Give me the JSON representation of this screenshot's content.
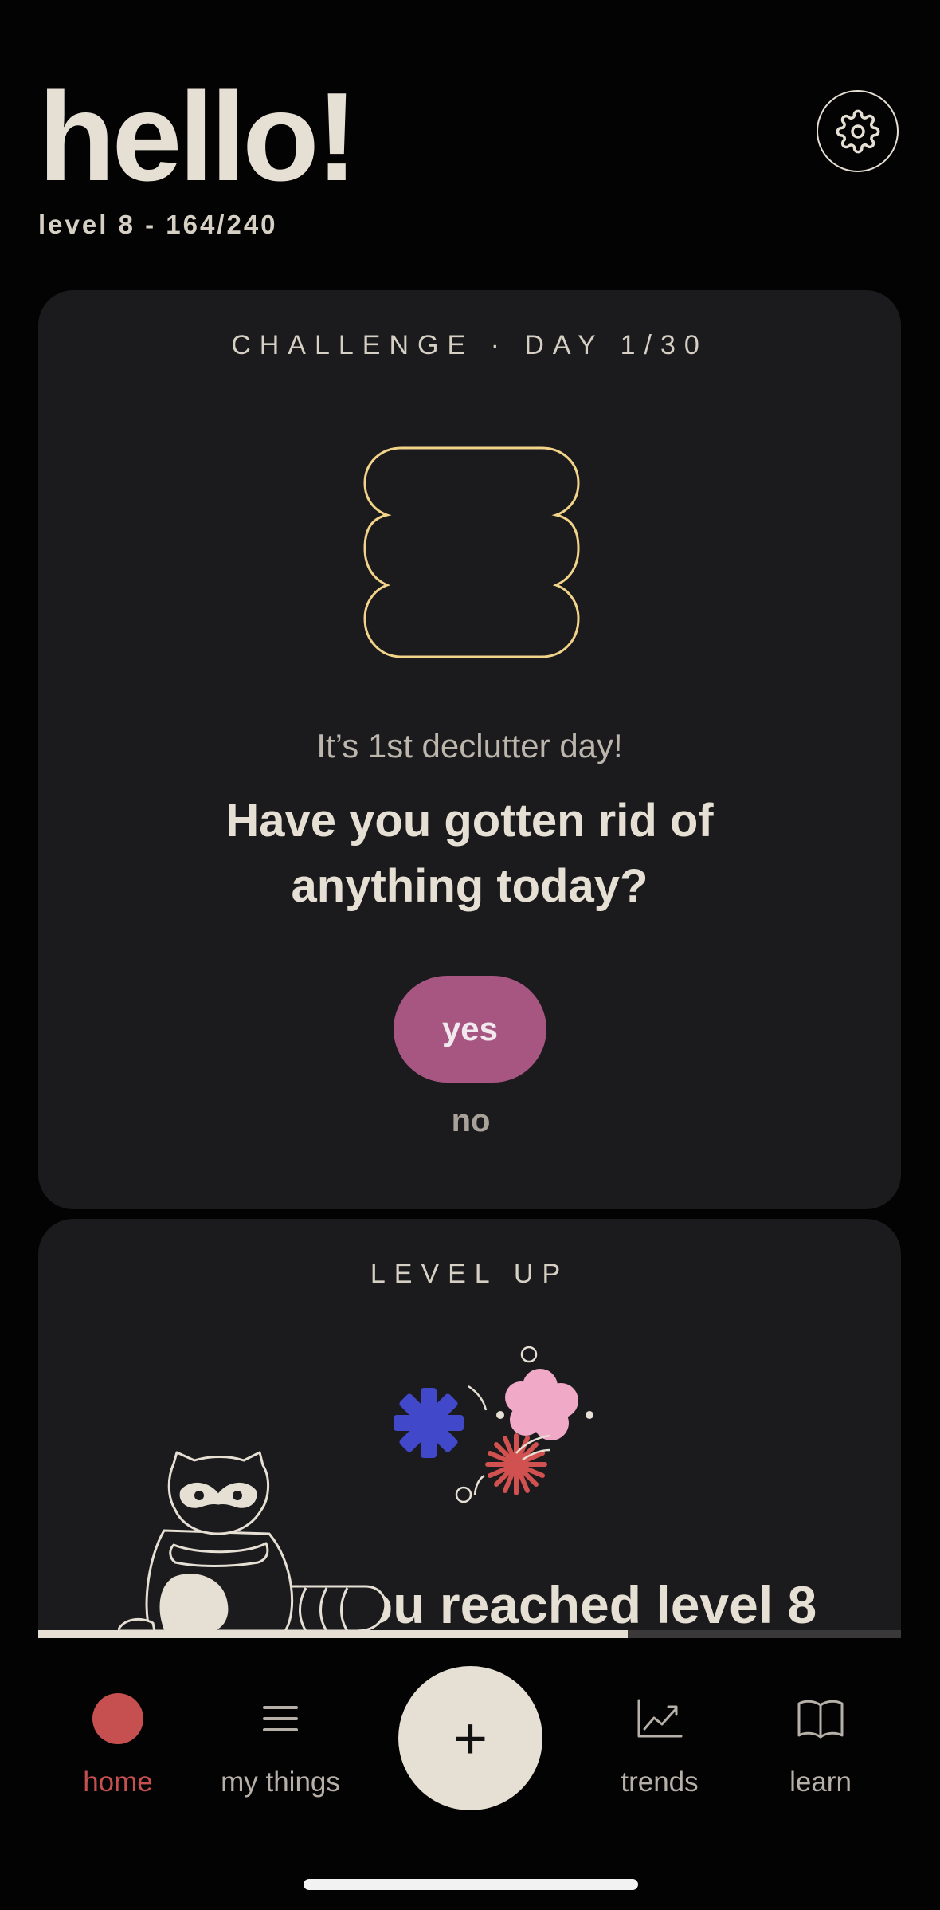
{
  "header": {
    "greeting": "hello!",
    "level_text": "level 8 - 164/240"
  },
  "challenge_card": {
    "label": "CHALLENGE · DAY 1/30",
    "subtitle": "It’s 1st declutter day!",
    "question": "Have you gotten rid of anything today?",
    "yes_label": "yes",
    "no_label": "no"
  },
  "level_card": {
    "label": "LEVEL UP",
    "title": "You reached level 8",
    "progress_fraction": 0.683
  },
  "nav": {
    "items": [
      {
        "label": "home",
        "icon": "dot-icon"
      },
      {
        "label": "my things",
        "icon": "list-icon"
      },
      {
        "label": "+",
        "icon": "plus-icon"
      },
      {
        "label": "trends",
        "icon": "trend-chart-icon"
      },
      {
        "label": "learn",
        "icon": "book-icon"
      }
    ]
  },
  "colors": {
    "background": "#030303",
    "card": "#1b1a1c",
    "text": "#e6dfd4",
    "accent_yes": "#a75682",
    "active_tab": "#c6504f",
    "blob_outline": "#f2d38a"
  }
}
